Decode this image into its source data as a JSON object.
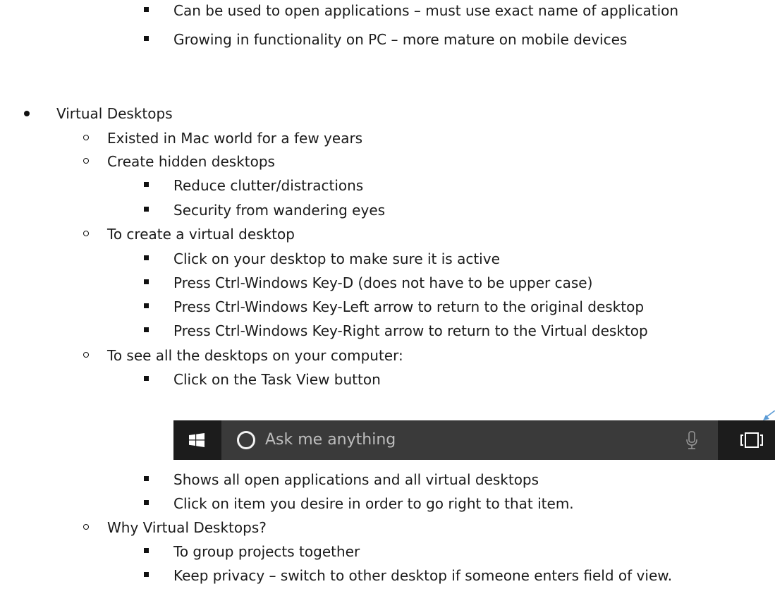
{
  "document": {
    "lines": [
      {
        "text": "Can be used to open applications – must use exact name of application"
      },
      {
        "text": "Growing in functionality on PC – more mature on mobile devices"
      },
      {
        "text": "Virtual Desktops"
      },
      {
        "text": "Existed in Mac world for a few years"
      },
      {
        "text": "Create hidden desktops"
      },
      {
        "text": "Reduce clutter/distractions"
      },
      {
        "text": "Security from wandering eyes"
      },
      {
        "text": "To create a virtual desktop"
      },
      {
        "text": "Click on your desktop to make sure it is active"
      },
      {
        "text": "Press Ctrl-Windows Key-D (does not have to be upper case)"
      },
      {
        "text": "Press Ctrl-Windows Key-Left arrow to return to the original desktop"
      },
      {
        "text": "Press Ctrl-Windows Key-Right arrow to return to the Virtual desktop"
      },
      {
        "text": "To see all the desktops on your computer:"
      },
      {
        "text": "Click on the Task View button"
      },
      {
        "text": "Shows all open applications and all virtual desktops"
      },
      {
        "text": "Click on item you desire in order to go right to that item."
      },
      {
        "text": "Why Virtual Desktops?"
      },
      {
        "text": "To group projects together"
      },
      {
        "text": "Keep privacy – switch to other desktop if someone enters field of view."
      }
    ]
  },
  "taskbar": {
    "search_placeholder": "Ask me anything",
    "icons": {
      "start": "windows-logo-icon",
      "cortana": "cortana-circle-icon",
      "mic": "microphone-icon",
      "task_view": "task-view-icon",
      "pointer": "arrow-pointer-icon"
    },
    "colors": {
      "bar": "#2b2b2b",
      "search_box": "#3a3a3a",
      "start_and_taskview": "#1c1c1c",
      "placeholder_text": "#bdbdbd",
      "arrow": "#5b9bd5"
    }
  }
}
